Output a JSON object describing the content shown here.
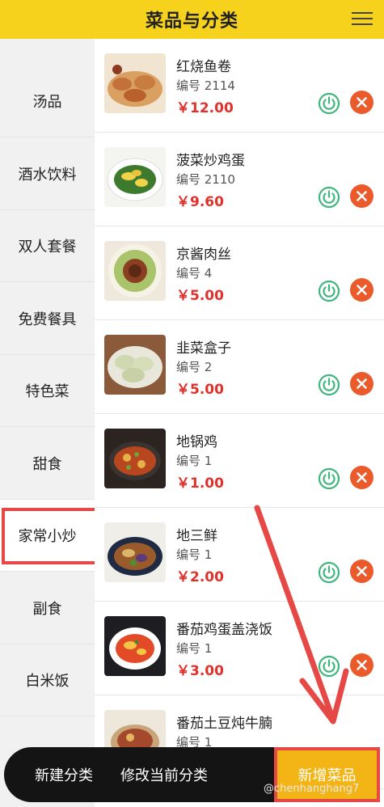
{
  "header": {
    "title": "菜品与分类",
    "menu_icon": "hamburger-menu-icon"
  },
  "sidebar": {
    "categories": [
      {
        "label": "汤品"
      },
      {
        "label": "酒水饮料"
      },
      {
        "label": "双人套餐"
      },
      {
        "label": "免费餐具"
      },
      {
        "label": "特色菜"
      },
      {
        "label": "甜食"
      },
      {
        "label": "家常小炒"
      },
      {
        "label": "副食"
      },
      {
        "label": "白米饭"
      }
    ],
    "selected": "家常小炒"
  },
  "dishes": [
    {
      "name": "红烧鱼卷",
      "code": "编号 2114",
      "price": "￥12.00"
    },
    {
      "name": "菠菜炒鸡蛋",
      "code": "编号 2110",
      "price": "￥9.60"
    },
    {
      "name": "京酱肉丝",
      "code": "编号 4",
      "price": "￥5.00"
    },
    {
      "name": "韭菜盒子",
      "code": "编号 2",
      "price": "￥5.00"
    },
    {
      "name": "地锅鸡",
      "code": "编号 1",
      "price": "￥1.00"
    },
    {
      "name": "地三鲜",
      "code": "编号 1",
      "price": "￥2.00"
    },
    {
      "name": "番茄鸡蛋盖浇饭",
      "code": "编号 1",
      "price": "￥3.00"
    },
    {
      "name": "番茄土豆炖牛腩",
      "code": "编号 1",
      "price": ""
    }
  ],
  "bottom_bar": {
    "new_category": "新建分类",
    "edit_category": "修改当前分类",
    "add_dish": "新增菜品"
  },
  "watermark": "@chenhanghang7",
  "colors": {
    "header_bg": "#f7d21c",
    "price": "#e0312b",
    "power_icon": "#3fb57e",
    "delete_button": "#ea5a2a",
    "highlight": "#e54845",
    "add_button": "#f3b516"
  }
}
